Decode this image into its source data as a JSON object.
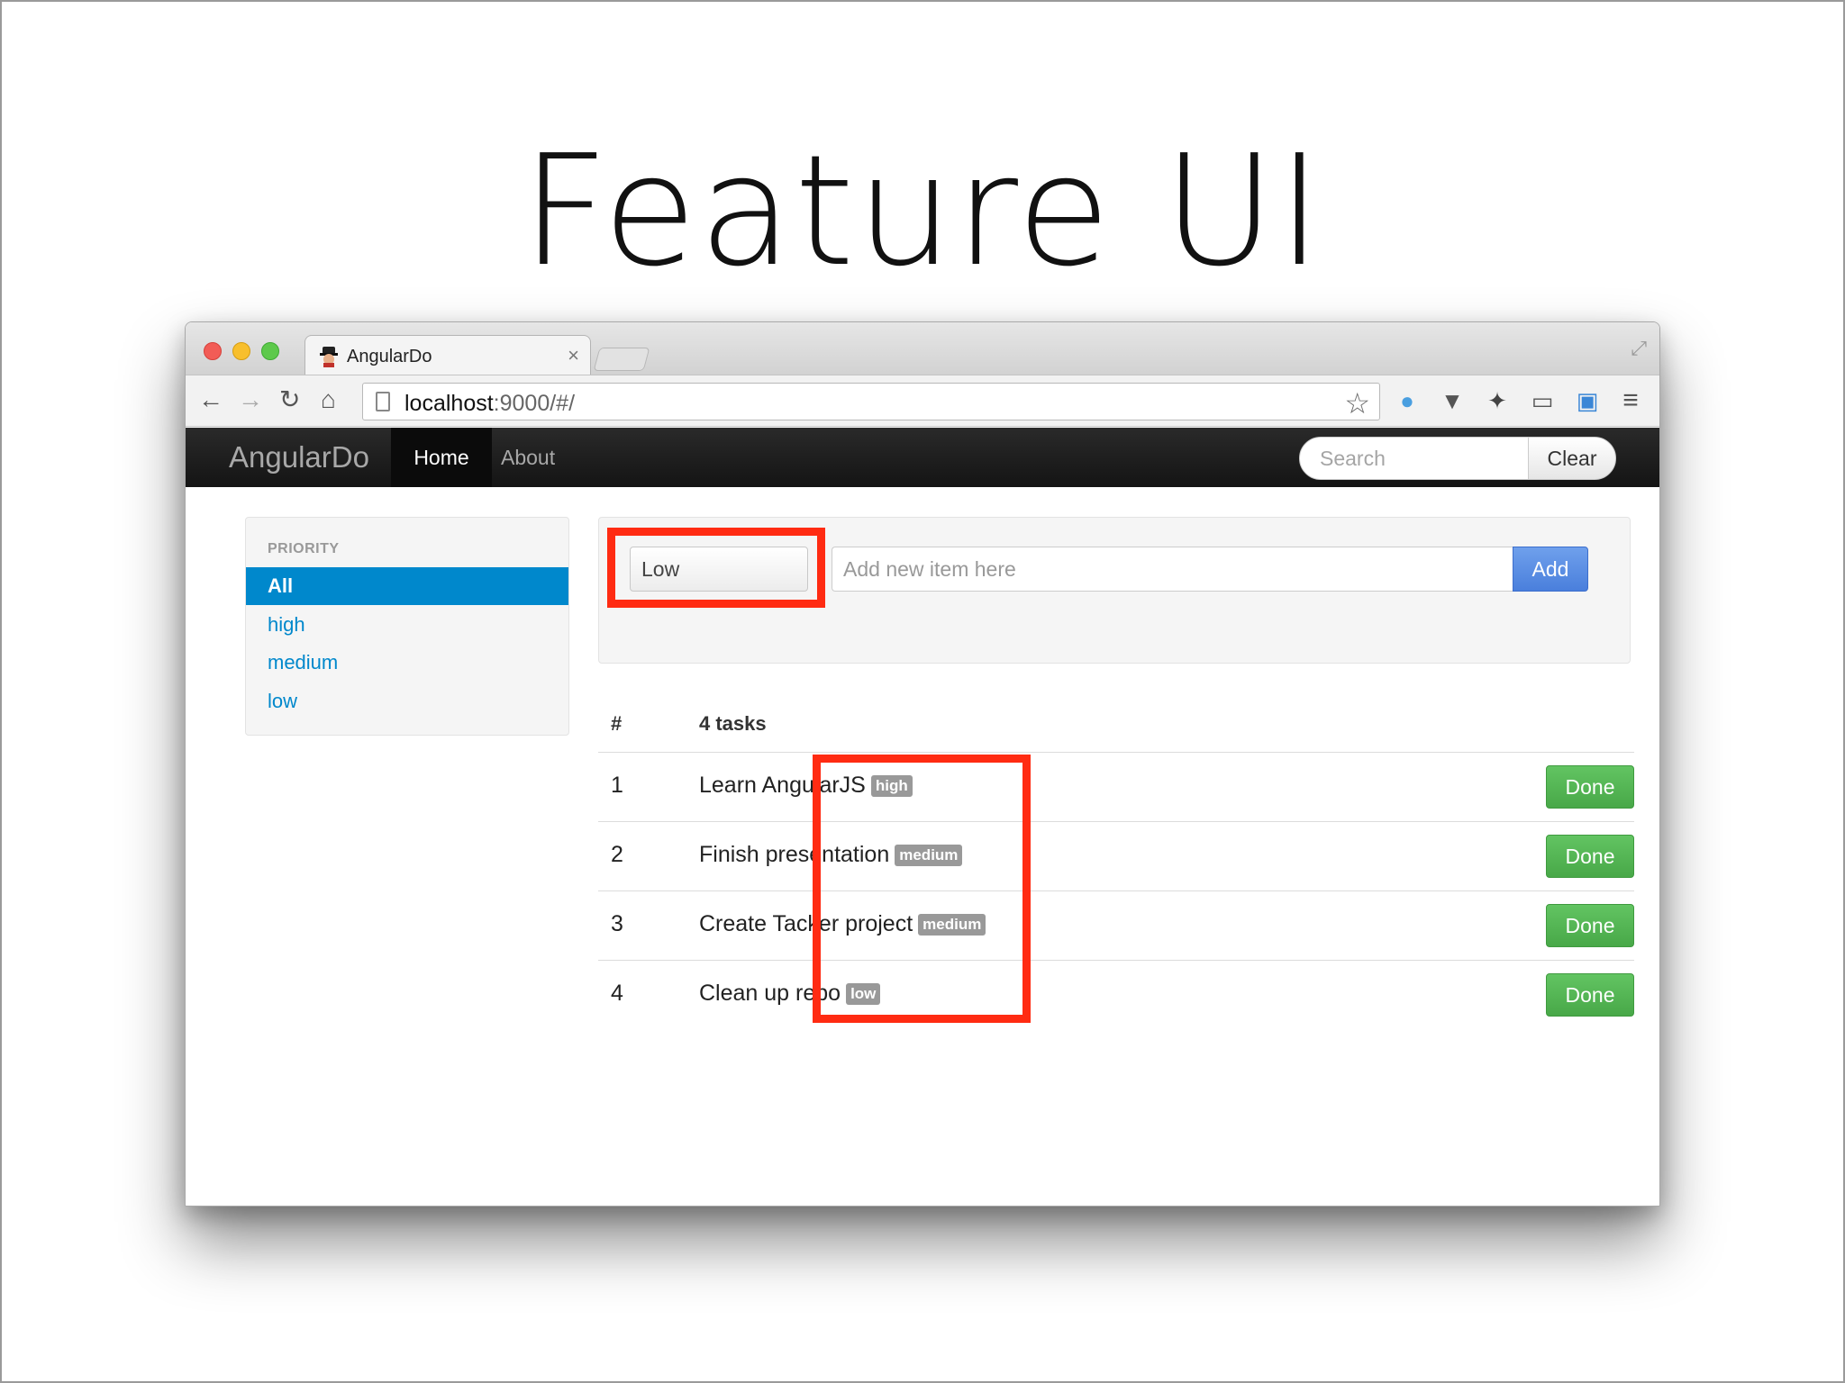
{
  "slide": {
    "title": "Feature UI"
  },
  "browser": {
    "tab_title": "AngularDo",
    "tab_close": "×",
    "url_host": "localhost",
    "url_rest": ":9000/#/"
  },
  "navbar": {
    "brand": "AngularDo",
    "home": "Home",
    "about": "About",
    "search_placeholder": "Search",
    "clear_label": "Clear"
  },
  "sidebar": {
    "header": "PRIORITY",
    "items": [
      {
        "label": "All",
        "active": true
      },
      {
        "label": "high"
      },
      {
        "label": "medium"
      },
      {
        "label": "low"
      }
    ]
  },
  "form": {
    "priority_value": "Low",
    "item_placeholder": "Add new item here",
    "add_label": "Add"
  },
  "tasks": {
    "col_num": "#",
    "col_title": "4 tasks",
    "done_label": "Done",
    "rows": [
      {
        "num": "1",
        "title": "Learn AngularJS",
        "priority": "high"
      },
      {
        "num": "2",
        "title": "Finish presentation",
        "priority": "medium"
      },
      {
        "num": "3",
        "title": "Create Tacker project",
        "priority": "medium"
      },
      {
        "num": "4",
        "title": "Clean up repo",
        "priority": "low"
      }
    ]
  },
  "colors": {
    "annotation": "#ff2b12",
    "nav_active": "#0088cc",
    "add_button": "#4a7fdc",
    "done_button": "#48a848",
    "badge": "#999999"
  }
}
